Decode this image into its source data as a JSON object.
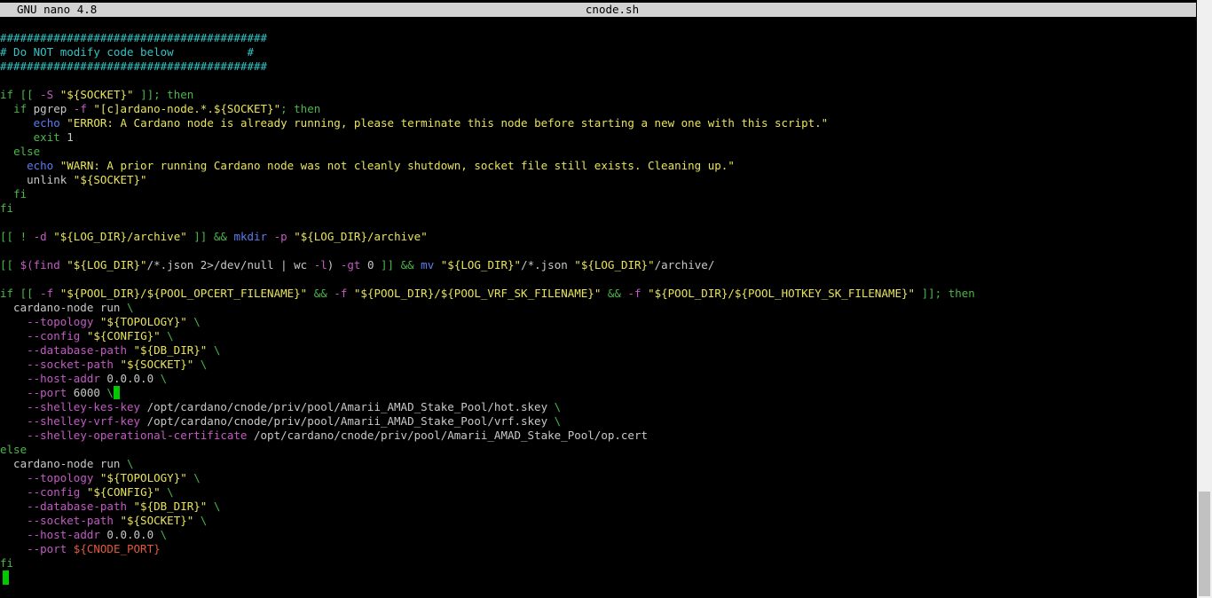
{
  "titlebar": {
    "app": "GNU nano 4.8",
    "filename": "cnode.sh"
  },
  "colors": {
    "comment": "#33c3c3",
    "keyword": "#4ab74a",
    "string": "#e8e35a",
    "option": "#c35bc3",
    "command": "#5c7cf0",
    "text": "#c8c8c8",
    "variable": "#e05a3a",
    "cursor": "#00c800"
  },
  "lines": [
    [
      [
        "comment",
        "########################################"
      ]
    ],
    [
      [
        "comment",
        "# Do NOT modify code below           #"
      ]
    ],
    [
      [
        "comment",
        "########################################"
      ]
    ],
    [],
    [
      [
        "keyword",
        "if [[ "
      ],
      [
        "option",
        "-S"
      ],
      [
        "text",
        " "
      ],
      [
        "string",
        "\"${SOCKET}\""
      ],
      [
        "keyword",
        " ]]; then"
      ]
    ],
    [
      [
        "text",
        "  "
      ],
      [
        "keyword",
        "if "
      ],
      [
        "text",
        "pgrep "
      ],
      [
        "option",
        "-f"
      ],
      [
        "text",
        " "
      ],
      [
        "string",
        "\"[c]ardano-node.*.${SOCKET}\""
      ],
      [
        "keyword",
        "; then"
      ]
    ],
    [
      [
        "text",
        "     "
      ],
      [
        "command",
        "echo"
      ],
      [
        "text",
        " "
      ],
      [
        "string",
        "\"ERROR: A Cardano node is already running, please terminate this node before starting a new one with this script.\""
      ]
    ],
    [
      [
        "text",
        "     "
      ],
      [
        "keyword",
        "exit"
      ],
      [
        "text",
        " 1"
      ]
    ],
    [
      [
        "text",
        "  "
      ],
      [
        "keyword",
        "else"
      ]
    ],
    [
      [
        "text",
        "    "
      ],
      [
        "command",
        "echo"
      ],
      [
        "text",
        " "
      ],
      [
        "string",
        "\"WARN: A prior running Cardano node was not cleanly shutdown, socket file still exists. Cleaning up.\""
      ]
    ],
    [
      [
        "text",
        "    unlink "
      ],
      [
        "string",
        "\"${SOCKET}\""
      ]
    ],
    [
      [
        "text",
        "  "
      ],
      [
        "keyword",
        "fi"
      ]
    ],
    [
      [
        "keyword",
        "fi"
      ]
    ],
    [],
    [
      [
        "keyword",
        "[[ ! "
      ],
      [
        "option",
        "-d"
      ],
      [
        "text",
        " "
      ],
      [
        "string",
        "\"${LOG_DIR}/archive\""
      ],
      [
        "keyword",
        " ]] && "
      ],
      [
        "command",
        "mkdir"
      ],
      [
        "text",
        " "
      ],
      [
        "option",
        "-p"
      ],
      [
        "text",
        " "
      ],
      [
        "string",
        "\"${LOG_DIR}/archive\""
      ]
    ],
    [],
    [
      [
        "keyword",
        "[[ "
      ],
      [
        "option",
        "$(find "
      ],
      [
        "string",
        "\"${LOG_DIR}\""
      ],
      [
        "text",
        "/*.json 2>/dev/null | wc "
      ],
      [
        "option",
        "-l"
      ],
      [
        "text",
        ") "
      ],
      [
        "option",
        "-gt"
      ],
      [
        "text",
        " 0 "
      ],
      [
        "keyword",
        "]] && "
      ],
      [
        "command",
        "mv"
      ],
      [
        "text",
        " "
      ],
      [
        "string",
        "\"${LOG_DIR}\""
      ],
      [
        "text",
        "/*.json "
      ],
      [
        "string",
        "\"${LOG_DIR}\""
      ],
      [
        "text",
        "/archive/"
      ]
    ],
    [],
    [
      [
        "keyword",
        "if [[ "
      ],
      [
        "option",
        "-f"
      ],
      [
        "text",
        " "
      ],
      [
        "string",
        "\"${POOL_DIR}/${POOL_OPCERT_FILENAME}\""
      ],
      [
        "keyword",
        " && "
      ],
      [
        "option",
        "-f"
      ],
      [
        "text",
        " "
      ],
      [
        "string",
        "\"${POOL_DIR}/${POOL_VRF_SK_FILENAME}\""
      ],
      [
        "keyword",
        " && "
      ],
      [
        "option",
        "-f"
      ],
      [
        "text",
        " "
      ],
      [
        "string",
        "\"${POOL_DIR}/${POOL_HOTKEY_SK_FILENAME}\""
      ],
      [
        "keyword",
        " ]]; then"
      ]
    ],
    [
      [
        "text",
        "  cardano-node run "
      ],
      [
        "keyword",
        "\\"
      ]
    ],
    [
      [
        "text",
        "    "
      ],
      [
        "option",
        "--topology"
      ],
      [
        "text",
        " "
      ],
      [
        "string",
        "\"${TOPOLOGY}\""
      ],
      [
        "keyword",
        " \\"
      ]
    ],
    [
      [
        "text",
        "    "
      ],
      [
        "option",
        "--config"
      ],
      [
        "text",
        " "
      ],
      [
        "string",
        "\"${CONFIG}\""
      ],
      [
        "keyword",
        " \\"
      ]
    ],
    [
      [
        "text",
        "    "
      ],
      [
        "option",
        "--database-path"
      ],
      [
        "text",
        " "
      ],
      [
        "string",
        "\"${DB_DIR}\""
      ],
      [
        "keyword",
        " \\"
      ]
    ],
    [
      [
        "text",
        "    "
      ],
      [
        "option",
        "--socket-path"
      ],
      [
        "text",
        " "
      ],
      [
        "string",
        "\"${SOCKET}\""
      ],
      [
        "keyword",
        " \\"
      ]
    ],
    [
      [
        "text",
        "    "
      ],
      [
        "option",
        "--host-addr"
      ],
      [
        "text",
        " 0.0.0.0 "
      ],
      [
        "keyword",
        "\\"
      ]
    ],
    [
      [
        "text",
        "    "
      ],
      [
        "option",
        "--port"
      ],
      [
        "text",
        " 6000 "
      ],
      [
        "keyword",
        "\\"
      ],
      [
        "cursor",
        ""
      ]
    ],
    [
      [
        "text",
        "    "
      ],
      [
        "option",
        "--shelley-kes-key"
      ],
      [
        "text",
        " /opt/cardano/cnode/priv/pool/Amarii_AMAD_Stake_Pool/hot.skey "
      ],
      [
        "keyword",
        "\\"
      ]
    ],
    [
      [
        "text",
        "    "
      ],
      [
        "option",
        "--shelley-vrf-key"
      ],
      [
        "text",
        " /opt/cardano/cnode/priv/pool/Amarii_AMAD_Stake_Pool/vrf.skey "
      ],
      [
        "keyword",
        "\\"
      ]
    ],
    [
      [
        "text",
        "    "
      ],
      [
        "option",
        "--shelley-operational-certificate"
      ],
      [
        "text",
        " /opt/cardano/cnode/priv/pool/Amarii_AMAD_Stake_Pool/op.cert"
      ]
    ],
    [
      [
        "keyword",
        "else"
      ]
    ],
    [
      [
        "text",
        "  cardano-node run "
      ],
      [
        "keyword",
        "\\"
      ]
    ],
    [
      [
        "text",
        "    "
      ],
      [
        "option",
        "--topology"
      ],
      [
        "text",
        " "
      ],
      [
        "string",
        "\"${TOPOLOGY}\""
      ],
      [
        "keyword",
        " \\"
      ]
    ],
    [
      [
        "text",
        "    "
      ],
      [
        "option",
        "--config"
      ],
      [
        "text",
        " "
      ],
      [
        "string",
        "\"${CONFIG}\""
      ],
      [
        "keyword",
        " \\"
      ]
    ],
    [
      [
        "text",
        "    "
      ],
      [
        "option",
        "--database-path"
      ],
      [
        "text",
        " "
      ],
      [
        "string",
        "\"${DB_DIR}\""
      ],
      [
        "keyword",
        " \\"
      ]
    ],
    [
      [
        "text",
        "    "
      ],
      [
        "option",
        "--socket-path"
      ],
      [
        "text",
        " "
      ],
      [
        "string",
        "\"${SOCKET}\""
      ],
      [
        "keyword",
        " \\"
      ]
    ],
    [
      [
        "text",
        "    "
      ],
      [
        "option",
        "--host-addr"
      ],
      [
        "text",
        " 0.0.0.0 "
      ],
      [
        "keyword",
        "\\"
      ]
    ],
    [
      [
        "text",
        "    "
      ],
      [
        "option",
        "--port"
      ],
      [
        "text",
        " "
      ],
      [
        "variable",
        "${CNODE_PORT}"
      ]
    ],
    [
      [
        "keyword",
        "fi"
      ]
    ]
  ]
}
